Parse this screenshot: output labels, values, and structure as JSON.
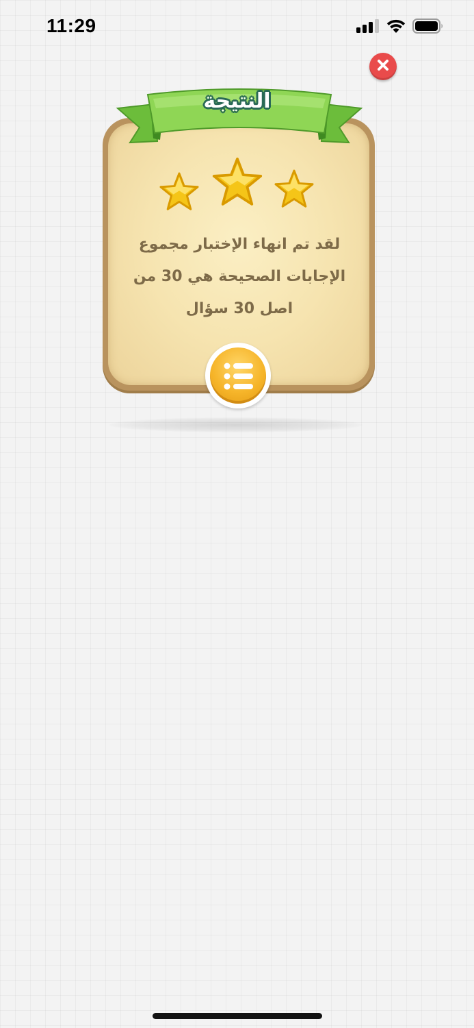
{
  "status_bar": {
    "time": "11:29",
    "icons": [
      "signal-icon",
      "wifi-icon",
      "battery-icon"
    ]
  },
  "result": {
    "title": "النتيجة",
    "stars_earned": 3,
    "stars_total": 3,
    "message": "لقد تم انهاء الإختبار مجموع الإجابات الصحيحة هي 30 من اصل 30 سؤال",
    "correct_answers": 30,
    "total_questions": 30
  },
  "colors": {
    "close_button": "#e94b4b",
    "ribbon_green": "#7fcf4a",
    "card_parchment": "#f6e4b0",
    "menu_button": "#f6b52a",
    "message_text": "#7d6a48"
  }
}
